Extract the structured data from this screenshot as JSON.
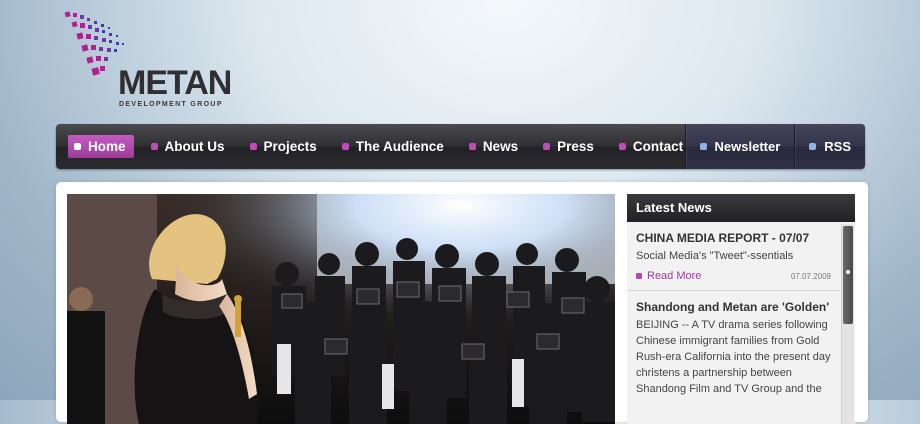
{
  "brand": {
    "name": "METAN",
    "tagline": "DEVELOPMENT GROUP",
    "accent_color": "#b04aab"
  },
  "nav": {
    "items": [
      {
        "label": "Home",
        "icon": "square-bullet",
        "active": true
      },
      {
        "label": "About Us",
        "icon": "square-bullet"
      },
      {
        "label": "Projects",
        "icon": "square-bullet"
      },
      {
        "label": "The Audience",
        "icon": "square-bullet"
      },
      {
        "label": "News",
        "icon": "square-bullet"
      },
      {
        "label": "Press",
        "icon": "square-bullet"
      },
      {
        "label": "Contact",
        "icon": "square-bullet"
      }
    ],
    "right": [
      {
        "label": "Newsletter",
        "icon": "square-bullet"
      },
      {
        "label": "RSS",
        "icon": "square-bullet"
      }
    ]
  },
  "hero": {
    "image": "photo of woman in black dress facing press photographers at red carpet event"
  },
  "latest_news": {
    "heading": "Latest News",
    "items": [
      {
        "title": "CHINA MEDIA REPORT - 07/07",
        "summary": "Social Media's \"Tweet\"-ssentials",
        "read_more": "Read More",
        "date": "07.07.2009"
      },
      {
        "title": "Shandong and Metan are 'Golden'",
        "summary": "BEIJING -- A TV drama series following Chinese immigrant families from Gold Rush-era California into the present day christens a partnership between Shandong Film and TV Group and the"
      }
    ]
  }
}
